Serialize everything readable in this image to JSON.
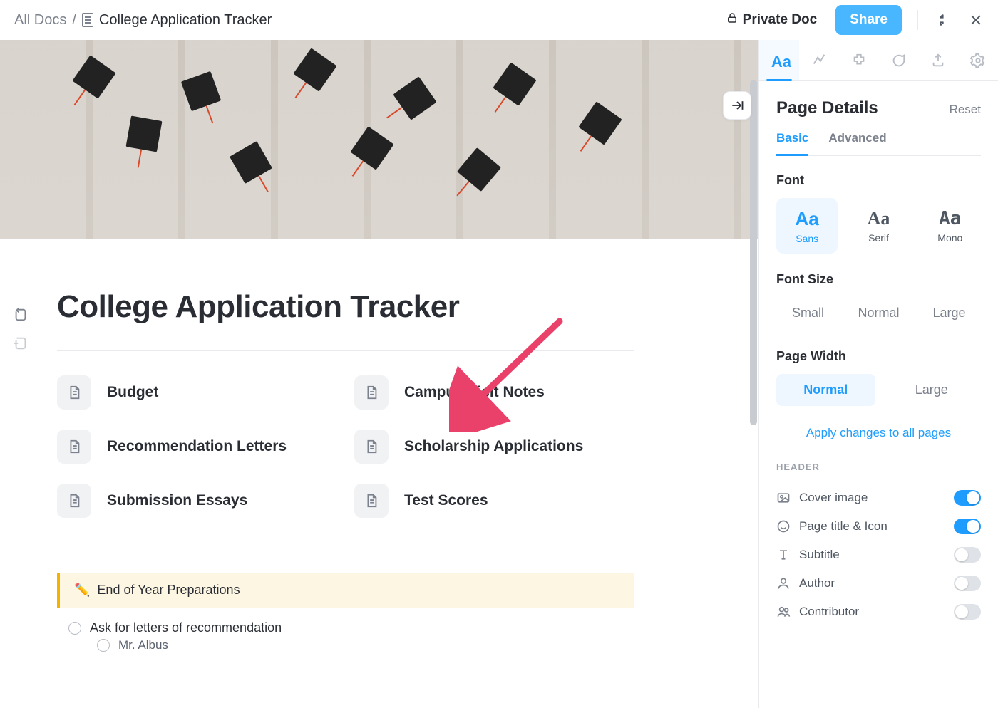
{
  "breadcrumb": {
    "root": "All Docs",
    "sep": "/",
    "current": "College Application Tracker"
  },
  "topbar": {
    "privacy": "Private Doc",
    "share": "Share"
  },
  "doc": {
    "title": "College Application Tracker",
    "pages": [
      "Budget",
      "Campus Visit Notes",
      "Recommendation Letters",
      "Scholarship Applications",
      "Submission Essays",
      "Test Scores"
    ],
    "callout_emoji": "✏️",
    "callout_text": "End of Year Preparations",
    "todos": [
      {
        "text": "Ask for letters of recommendation",
        "level": 0
      },
      {
        "text": "Mr. Albus",
        "level": 1
      }
    ]
  },
  "panel": {
    "title": "Page Details",
    "reset": "Reset",
    "tabs": {
      "basic": "Basic",
      "advanced": "Advanced"
    },
    "font": {
      "label": "Font",
      "options": {
        "sans": "Sans",
        "serif": "Serif",
        "mono": "Mono"
      },
      "sample": "Aa",
      "active": "sans"
    },
    "font_size": {
      "label": "Font Size",
      "options": [
        "Small",
        "Normal",
        "Large"
      ],
      "active": null
    },
    "page_width": {
      "label": "Page Width",
      "options": [
        "Normal",
        "Large"
      ],
      "active": "Normal"
    },
    "apply_all": "Apply changes to all pages",
    "header_label": "HEADER",
    "header_rows": [
      {
        "key": "cover",
        "label": "Cover image",
        "on": true
      },
      {
        "key": "title",
        "label": "Page title & Icon",
        "on": true
      },
      {
        "key": "subtitle",
        "label": "Subtitle",
        "on": false
      },
      {
        "key": "author",
        "label": "Author",
        "on": false
      },
      {
        "key": "contrib",
        "label": "Contributor",
        "on": false
      }
    ]
  }
}
